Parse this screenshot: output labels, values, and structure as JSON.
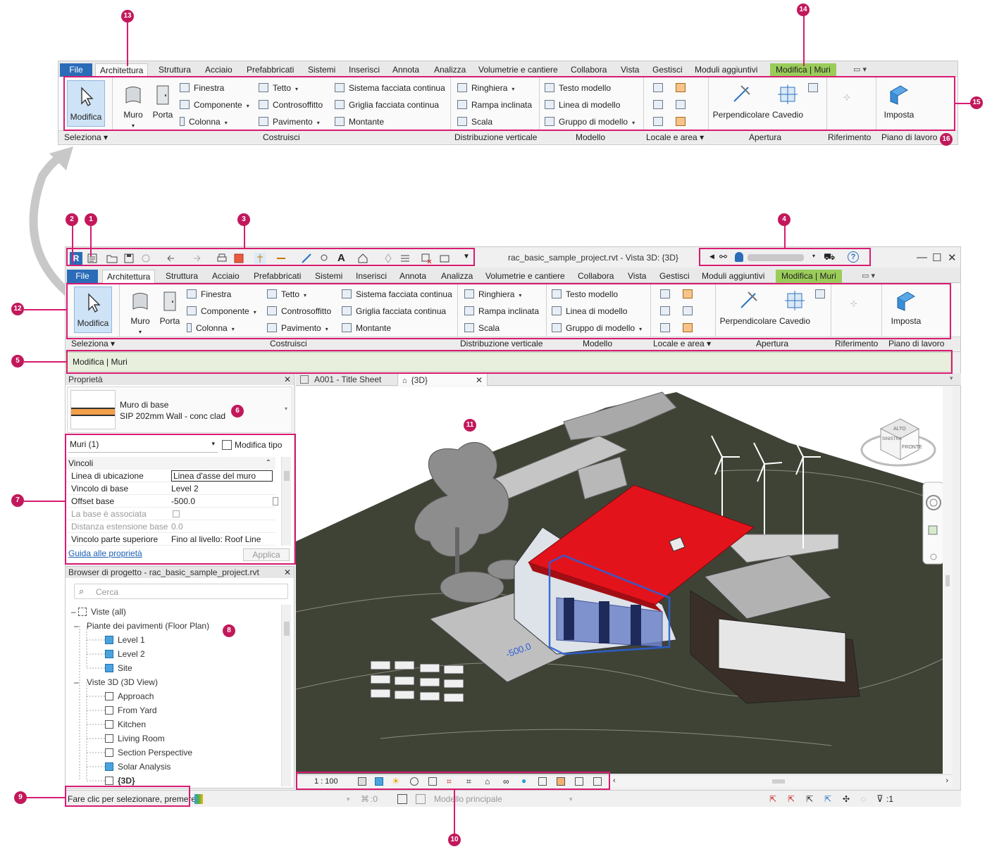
{
  "colors": {
    "accent": "#d81b72",
    "file_tab": "#2b6cb8",
    "contextual_tab": "#9acc5a",
    "roof": "#e3131b",
    "terrain": "#3f4336"
  },
  "callouts": [
    "1",
    "2",
    "3",
    "4",
    "5",
    "6",
    "7",
    "8",
    "9",
    "10",
    "11",
    "12",
    "13",
    "14",
    "15",
    "16"
  ],
  "ribbon": {
    "tabs": [
      "File",
      "Architettura",
      "Struttura",
      "Acciaio",
      "Prefabbricati",
      "Sistemi",
      "Inserisci",
      "Annota",
      "Analizza",
      "Volumetrie e cantiere",
      "Collabora",
      "Vista",
      "Gestisci",
      "Moduli aggiuntivi",
      "Modifica | Muri"
    ],
    "select_big": "Modifica",
    "build": {
      "wall": "Muro",
      "door": "Porta",
      "window": "Finestra",
      "component": "Componente",
      "column": "Colonna",
      "roof": "Tetto",
      "ceiling": "Controsoffitto",
      "floor": "Pavimento",
      "curtain_system": "Sistema facciata continua",
      "curtain_grid": "Griglia facciata continua",
      "mullion": "Montante"
    },
    "circulation": {
      "railing": "Ringhiera",
      "ramp": "Rampa inclinata",
      "stair": "Scala"
    },
    "model": {
      "text": "Testo modello",
      "line": "Linea di modello",
      "group": "Gruppo di modello"
    },
    "opening": {
      "perpendicular": "Perpendicolare",
      "shaft": "Cavedio"
    },
    "workplane": {
      "set": "Imposta"
    },
    "panels": [
      "Seleziona",
      "Costruisci",
      "Distribuzione verticale",
      "Modello",
      "Locale e area",
      "Apertura",
      "Riferimento",
      "Piano di lavoro"
    ]
  },
  "window": {
    "title": "rac_basic_sample_project.rvt - Vista 3D: {3D}",
    "options_bar": "Modifica | Muri"
  },
  "properties": {
    "header": "Proprietà",
    "type_name": "Muro di base",
    "type_sub": "SIP 202mm Wall - conc clad",
    "filter": "Muri (1)",
    "edit_type": "Modifica tipo",
    "group": "Vincoli",
    "rows": [
      {
        "k": "Linea di ubicazione",
        "v": "Linea d'asse del muro"
      },
      {
        "k": "Vincolo di base",
        "v": "Level 2"
      },
      {
        "k": "Offset base",
        "v": "-500.0"
      },
      {
        "k": "La base è associata",
        "v": ""
      },
      {
        "k": "Distanza estensione base",
        "v": "0.0"
      },
      {
        "k": "Vincolo parte superiore",
        "v": "Fino al livello: Roof Line"
      }
    ],
    "help": "Guida alle proprietà",
    "apply": "Applica"
  },
  "browser": {
    "header": "Browser di progetto - rac_basic_sample_project.rvt",
    "search": "Cerca",
    "items": [
      {
        "t": "Viste (all)",
        "lvl": 0
      },
      {
        "t": "Piante dei pavimenti (Floor Plan)",
        "lvl": 1
      },
      {
        "t": "Level 1",
        "lvl": 2
      },
      {
        "t": "Level 2",
        "lvl": 2
      },
      {
        "t": "Site",
        "lvl": 2
      },
      {
        "t": "Viste 3D (3D View)",
        "lvl": 1
      },
      {
        "t": "Approach",
        "lvl": 2
      },
      {
        "t": "From Yard",
        "lvl": 2
      },
      {
        "t": "Kitchen",
        "lvl": 2
      },
      {
        "t": "Living Room",
        "lvl": 2
      },
      {
        "t": "Section Perspective",
        "lvl": 2
      },
      {
        "t": "Solar Analysis",
        "lvl": 2
      },
      {
        "t": "{3D}",
        "lvl": 2
      }
    ]
  },
  "view_tabs": {
    "sheet": "A001 - Title Sheet",
    "view3d": "{3D}"
  },
  "viewcube": {
    "top": "ALTO",
    "front": "FRONTE",
    "left": "SINISTRA"
  },
  "view_control": {
    "scale": "1 : 100"
  },
  "status": {
    "message": "Fare clic per selezionare, premere",
    "workset": ":0",
    "model": "Modello principale",
    "filter": ":1"
  }
}
